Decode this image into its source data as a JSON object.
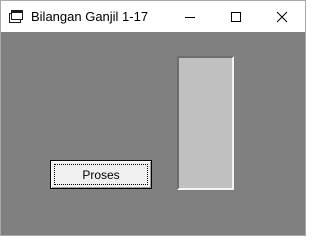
{
  "window": {
    "title": "Bilangan Ganjil 1-17",
    "icon": "app-window-icon",
    "controls": [
      "minimize-icon",
      "maximize-icon",
      "close-icon"
    ]
  },
  "form": {
    "button_label": "Proses",
    "list_items": []
  },
  "colors": {
    "client_background": "#808080",
    "list_background": "#c0c0c0",
    "button_face": "#f0f0f0",
    "titlebar": "#ffffff"
  }
}
